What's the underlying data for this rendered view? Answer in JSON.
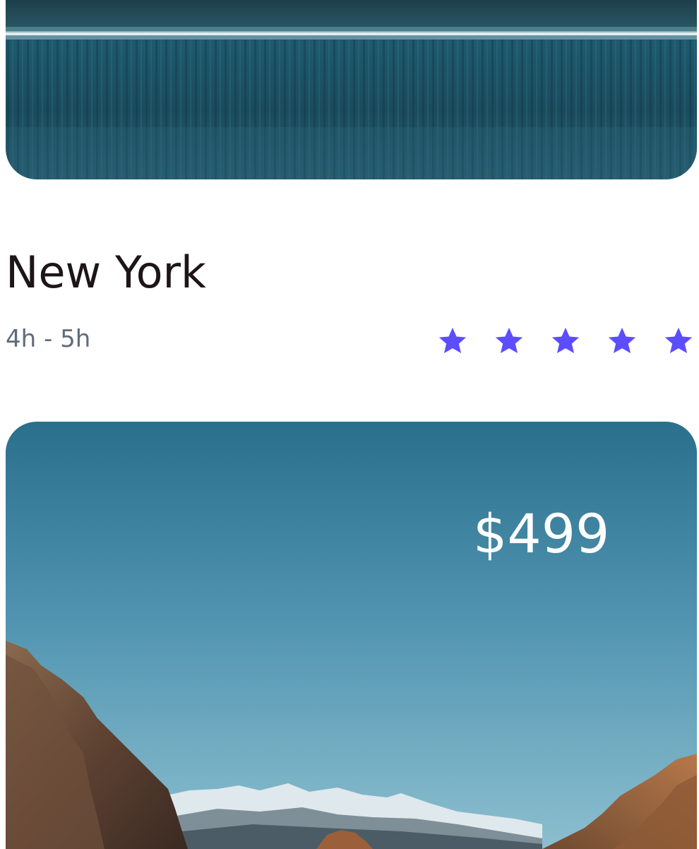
{
  "card_top": {
    "image": "lake-forest-photo",
    "title": "New York",
    "duration": "4h - 5h",
    "rating": 5,
    "star_icon": "star-icon",
    "star_color": "#5c4dff"
  },
  "card_bottom": {
    "image": "mountain-rocks-photo",
    "price": "$499"
  }
}
